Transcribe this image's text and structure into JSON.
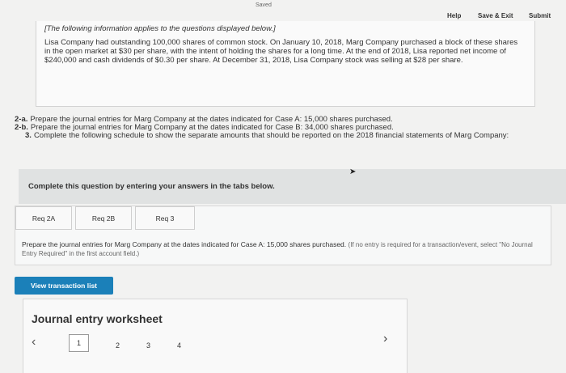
{
  "topbar": {
    "saved": "Saved",
    "help": "Help",
    "save_exit": "Save & Exit",
    "submit": "Submit"
  },
  "info": {
    "heading": "[The following information applies to the questions displayed below.]",
    "body": "Lisa Company had outstanding 100,000 shares of common stock. On January 10, 2018, Marg Company purchased a block of these shares in the open market at $30 per share, with the intent of holding the shares for a long time. At the end of 2018, Lisa reported net income of $240,000 and cash dividends of $0.30 per share. At December 31, 2018, Lisa Company stock was selling at $28 per share."
  },
  "requirements": [
    {
      "label": "2-a.",
      "text": "Prepare the journal entries for Marg Company at the dates indicated for Case A: 15,000 shares purchased."
    },
    {
      "label": "2-b.",
      "text": "Prepare the journal entries for Marg Company at the dates indicated for Case B: 34,000 shares purchased."
    },
    {
      "label": "3.",
      "text": "Complete the following schedule to show the separate amounts that should be reported on the 2018 financial statements of Marg Company:"
    }
  ],
  "instruction_bar": "Complete this question by entering your answers in the tabs below.",
  "tabs": [
    {
      "label": "Req 2A"
    },
    {
      "label": "Req 2B"
    },
    {
      "label": "Req 3"
    }
  ],
  "tab_content": {
    "instruction": "Prepare the journal entries for Marg Company at the dates indicated for Case A: 15,000 shares purchased.",
    "hint": "(If no entry is required for a transaction/event, select \"No Journal Entry Required\" in the first account field.)"
  },
  "view_transaction_label": "View transaction list",
  "worksheet": {
    "title": "Journal entry worksheet",
    "prev_icon": "chevron-left-icon",
    "next_icon": "chevron-right-icon",
    "pages": [
      "1",
      "2",
      "3",
      "4"
    ],
    "active_page": "1"
  }
}
